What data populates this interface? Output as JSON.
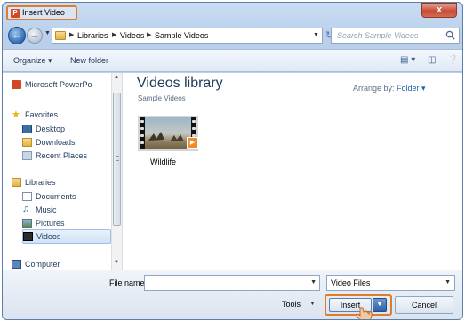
{
  "window": {
    "title": "Insert Video",
    "app_icon_letter": "P",
    "close_glyph": "x"
  },
  "nav": {
    "breadcrumbs": [
      "Libraries",
      "Videos",
      "Sample Videos"
    ],
    "search_placeholder": "Search Sample Videos"
  },
  "toolbar": {
    "organize_label": "Organize ▾",
    "new_folder_label": "New folder"
  },
  "navpane": {
    "items": [
      {
        "label": "Microsoft PowerPo",
        "icon": "powerpoint-icon"
      },
      {
        "label": "Favorites",
        "icon": "star-icon"
      },
      {
        "label": "Desktop",
        "icon": "desktop-icon"
      },
      {
        "label": "Downloads",
        "icon": "downloads-icon"
      },
      {
        "label": "Recent Places",
        "icon": "recent-places-icon"
      },
      {
        "label": "Libraries",
        "icon": "library-icon"
      },
      {
        "label": "Documents",
        "icon": "documents-icon"
      },
      {
        "label": "Music",
        "icon": "music-icon"
      },
      {
        "label": "Pictures",
        "icon": "pictures-icon"
      },
      {
        "label": "Videos",
        "icon": "videos-icon"
      },
      {
        "label": "Computer",
        "icon": "computer-icon"
      }
    ]
  },
  "main": {
    "library_title": "Videos library",
    "library_subtitle": "Sample Videos",
    "arrange_label": "Arrange by:",
    "arrange_value": "Folder ▾",
    "files": [
      {
        "name": "Wildlife"
      }
    ]
  },
  "footer": {
    "file_name_label": "File name:",
    "file_name_value": "",
    "file_type_value": "Video Files",
    "tools_label": "Tools",
    "insert_label": "Insert",
    "cancel_label": "Cancel"
  },
  "colors": {
    "highlight": "#e07b2a",
    "accent": "#1f5fa8"
  }
}
